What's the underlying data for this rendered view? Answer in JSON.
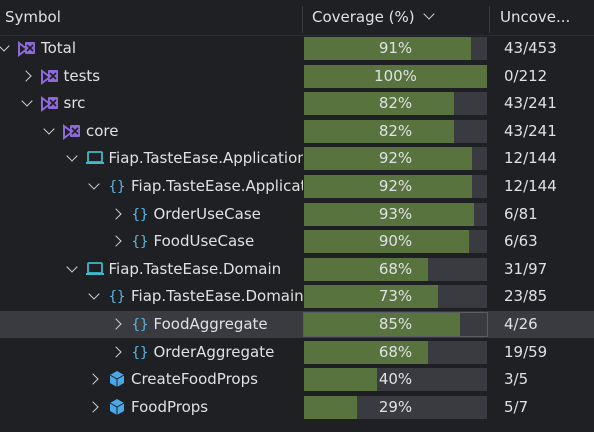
{
  "header": {
    "symbol": "Symbol",
    "coverage": "Coverage (%)",
    "uncovered": "Uncove..."
  },
  "rows": [
    {
      "label": "Total",
      "icon": "solution-icon",
      "depth": 0,
      "arrow": "expanded",
      "pct": "91%",
      "value": 91,
      "uncovered": "43/453"
    },
    {
      "label": "tests",
      "icon": "solution-icon",
      "depth": 1,
      "arrow": "collapsed",
      "pct": "100%",
      "value": 100,
      "uncovered": "0/212"
    },
    {
      "label": "src",
      "icon": "solution-icon",
      "depth": 1,
      "arrow": "expanded",
      "pct": "82%",
      "value": 82,
      "uncovered": "43/241"
    },
    {
      "label": "core",
      "icon": "solution-icon",
      "depth": 2,
      "arrow": "expanded",
      "pct": "82%",
      "value": 82,
      "uncovered": "43/241"
    },
    {
      "label": "Fiap.TasteEase.Application",
      "icon": "project-icon",
      "depth": 3,
      "arrow": "expanded",
      "pct": "92%",
      "value": 92,
      "uncovered": "12/144"
    },
    {
      "label": "Fiap.TasteEase.Application",
      "icon": "namespace-icon",
      "depth": 4,
      "arrow": "expanded",
      "pct": "92%",
      "value": 92,
      "uncovered": "12/144"
    },
    {
      "label": "OrderUseCase",
      "icon": "namespace-icon",
      "depth": 5,
      "arrow": "collapsed",
      "pct": "93%",
      "value": 93,
      "uncovered": "6/81"
    },
    {
      "label": "FoodUseCase",
      "icon": "namespace-icon",
      "depth": 5,
      "arrow": "collapsed",
      "pct": "90%",
      "value": 90,
      "uncovered": "6/63"
    },
    {
      "label": "Fiap.TasteEase.Domain",
      "icon": "project-icon",
      "depth": 3,
      "arrow": "expanded",
      "pct": "68%",
      "value": 68,
      "uncovered": "31/97"
    },
    {
      "label": "Fiap.TasteEase.Domain",
      "icon": "namespace-icon",
      "depth": 4,
      "arrow": "expanded",
      "pct": "73%",
      "value": 73,
      "uncovered": "23/85"
    },
    {
      "label": "FoodAggregate",
      "icon": "namespace-icon",
      "depth": 5,
      "arrow": "collapsed",
      "pct": "85%",
      "value": 85,
      "uncovered": "4/26",
      "selected": true
    },
    {
      "label": "OrderAggregate",
      "icon": "namespace-icon",
      "depth": 5,
      "arrow": "collapsed",
      "pct": "68%",
      "value": 68,
      "uncovered": "19/59"
    },
    {
      "label": "CreateFoodProps",
      "icon": "class-icon",
      "depth": 4,
      "arrow": "collapsed",
      "pct": "40%",
      "value": 40,
      "uncovered": "3/5"
    },
    {
      "label": "FoodProps",
      "icon": "class-icon",
      "depth": 4,
      "arrow": "collapsed",
      "pct": "29%",
      "value": 29,
      "uncovered": "5/7"
    }
  ],
  "colors": {
    "fill": "#59733f",
    "track": "#393b40",
    "selected": "#393b40",
    "solution_icon": "#8e6ad8",
    "project_icon": "#3fb8c9",
    "namespace_icon": "#5db5e0",
    "class_icon": "#4aa8e8"
  }
}
